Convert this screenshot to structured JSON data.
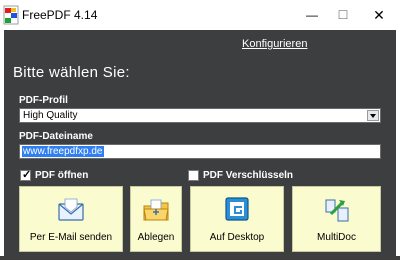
{
  "window": {
    "title": "FreePDF 4.14",
    "controls": {
      "minimize": "—",
      "maximize": "☐",
      "close": "✕"
    }
  },
  "header": {
    "configure_link": "Konfigurieren",
    "prompt": "Bitte wählen Sie:"
  },
  "profile": {
    "label": "PDF-Profil",
    "selected": "High Quality"
  },
  "filename": {
    "label": "PDF-Dateiname",
    "value": "www.freepdfxp.de"
  },
  "options": {
    "open_pdf": {
      "label": "PDF öffnen",
      "checked": true
    },
    "encrypt_pdf": {
      "label": "PDF Verschlüsseln",
      "checked": false
    }
  },
  "actions": [
    {
      "label": "Per E-Mail senden",
      "icon": "envelope-icon"
    },
    {
      "label": "Ablegen",
      "icon": "folder-icon"
    },
    {
      "label": "Auf Desktop",
      "icon": "desktop-icon"
    },
    {
      "label": "MultiDoc",
      "icon": "multidoc-icon"
    }
  ],
  "colors": {
    "client_background": "#3d3e40",
    "button_background": "#fbfbd0",
    "selection": "#2f7ff0"
  }
}
